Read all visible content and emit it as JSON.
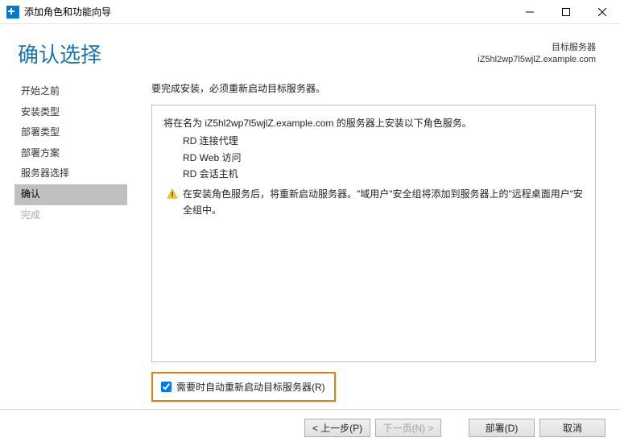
{
  "window": {
    "title": "添加角色和功能向导"
  },
  "header": {
    "page_title": "确认选择",
    "target_label": "目标服务器",
    "target_value": "iZ5hl2wp7l5wjlZ.example.com"
  },
  "sidebar": {
    "items": [
      {
        "label": "开始之前",
        "state": "normal"
      },
      {
        "label": "安装类型",
        "state": "normal"
      },
      {
        "label": "部署类型",
        "state": "normal"
      },
      {
        "label": "部署方案",
        "state": "normal"
      },
      {
        "label": "服务器选择",
        "state": "normal"
      },
      {
        "label": "确认",
        "state": "active"
      },
      {
        "label": "完成",
        "state": "disabled"
      }
    ]
  },
  "content": {
    "description": "要完成安装，必须重新启动目标服务器。",
    "install_line": "将在名为 iZ5hl2wp7l5wjlZ.example.com 的服务器上安装以下角色服务。",
    "roles": [
      "RD 连接代理",
      "RD Web 访问",
      "RD 会话主机"
    ],
    "warning": "在安装角色服务后，将重新启动服务器。\"域用户\"安全组将添加到服务器上的\"远程桌面用户\"安全组中。",
    "checkbox_label": "需要时自动重新启动目标服务器(R)"
  },
  "footer": {
    "prev": "< 上一步(P)",
    "next": "下一页(N) >",
    "deploy": "部署(D)",
    "cancel": "取消"
  }
}
